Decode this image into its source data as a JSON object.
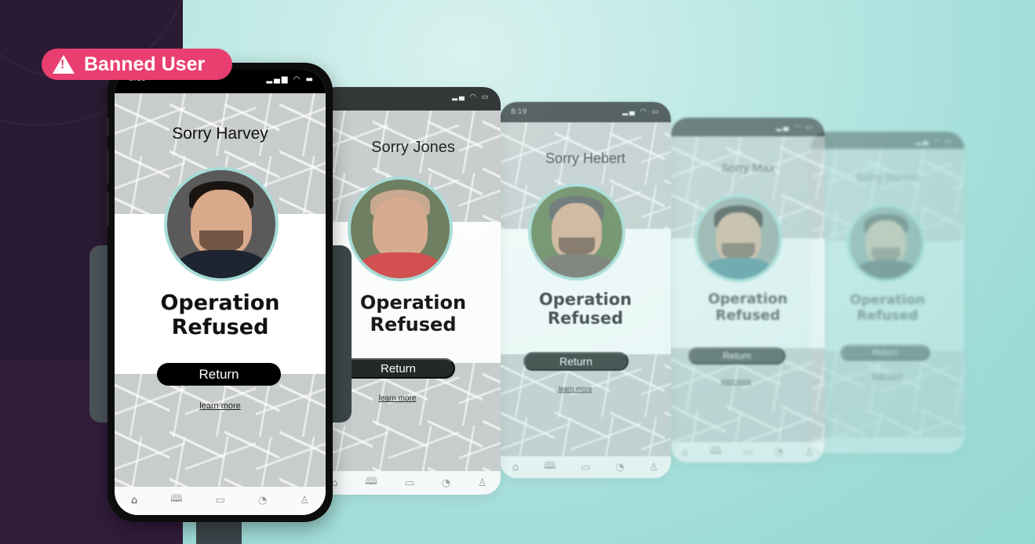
{
  "badge": {
    "icon": "warning-triangle-icon",
    "label": "Banned User",
    "color": "#e93e70"
  },
  "status_bar": {
    "time": "8:19",
    "icons": [
      "signal-icon",
      "wifi-icon",
      "battery-icon"
    ]
  },
  "screens": [
    {
      "greeting": "Sorry Harvey",
      "title_line1": "Operation",
      "title_line2": "Refused",
      "button_label": "Return",
      "link_label": "learn more"
    },
    {
      "greeting": "Sorry Jones",
      "title_line1": "Operation",
      "title_line2": "Refused",
      "button_label": "Return",
      "link_label": "learn more"
    },
    {
      "greeting": "Sorry Hebert",
      "title_line1": "Operation",
      "title_line2": "Refused",
      "button_label": "Return",
      "link_label": "learn more"
    },
    {
      "greeting": "Sorry Max",
      "title_line1": "Operation",
      "title_line2": "Refused",
      "button_label": "Return",
      "link_label": "learn more"
    },
    {
      "greeting": "Sorry Steven",
      "title_line1": "Operation",
      "title_line2": "Refused",
      "button_label": "Return",
      "link_label": "learn more"
    }
  ],
  "tab_bar": {
    "tabs": [
      {
        "icon": "home-icon",
        "glyph": "⌂",
        "active": true
      },
      {
        "icon": "book-icon",
        "glyph": "🕮",
        "active": false
      },
      {
        "icon": "chat-icon",
        "glyph": "▭",
        "active": false
      },
      {
        "icon": "chart-pie-icon",
        "glyph": "◔",
        "active": false
      },
      {
        "icon": "user-icon",
        "glyph": "♙",
        "active": false
      }
    ]
  },
  "colors": {
    "accent_pink": "#e93e70",
    "avatar_ring": "#a7dcd8",
    "background_teal": "#9fdcd8",
    "left_panel": "#2b1a33"
  }
}
